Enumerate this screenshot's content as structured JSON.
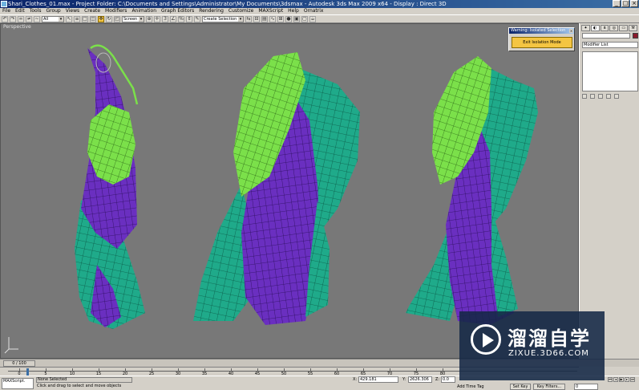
{
  "window": {
    "title": "Shari_Clothes_01.max - Project Folder: C:\\Documents and Settings\\Administrator\\My Documents\\3dsmax - Autodesk 3ds Max 2009 x64 - Display : Direct 3D"
  },
  "menu": [
    "File",
    "Edit",
    "Tools",
    "Group",
    "Views",
    "Create",
    "Modifiers",
    "Animation",
    "Graph Editors",
    "Rendering",
    "Customize",
    "MAXScript",
    "Help",
    "Ornatrix"
  ],
  "toolbar": {
    "filter_value": "All",
    "view_value": "Screen",
    "selection_set_placeholder": "Create Selection Set"
  },
  "viewport": {
    "label": "Perspective"
  },
  "isolate_dialog": {
    "title": "Warning: Isolated Selection",
    "exit_button": "Exit Isolation Mode"
  },
  "command_panel": {
    "modifier_list": "Modifier List"
  },
  "timeline": {
    "slider": "0 / 100",
    "ticks": [
      "0",
      "5",
      "10",
      "15",
      "20",
      "25",
      "30",
      "35",
      "40",
      "45",
      "50",
      "55",
      "60",
      "65",
      "70",
      "75",
      "80"
    ]
  },
  "status": {
    "maxscript": "MAXScript.",
    "selection": "None Selected",
    "prompt": "Click and drag to select and move objects",
    "x_label": "X:",
    "x_value": "429.181",
    "y_label": "Y:",
    "y_value": "2626.306",
    "z_label": "Z:",
    "z_value": "0.0",
    "add_time_tag": "Add Time Tag",
    "set_key": "Set Key",
    "key_filters": "Key Filters...",
    "frame": "0"
  },
  "watermark": {
    "brand_cn": "溜溜自学",
    "url": "ZIXUE.3D66.COM"
  },
  "colors": {
    "green": "#7be04a",
    "purple": "#6a2fc0",
    "teal": "#1faa8a",
    "background": "#787878",
    "accent": "#f4c542"
  }
}
